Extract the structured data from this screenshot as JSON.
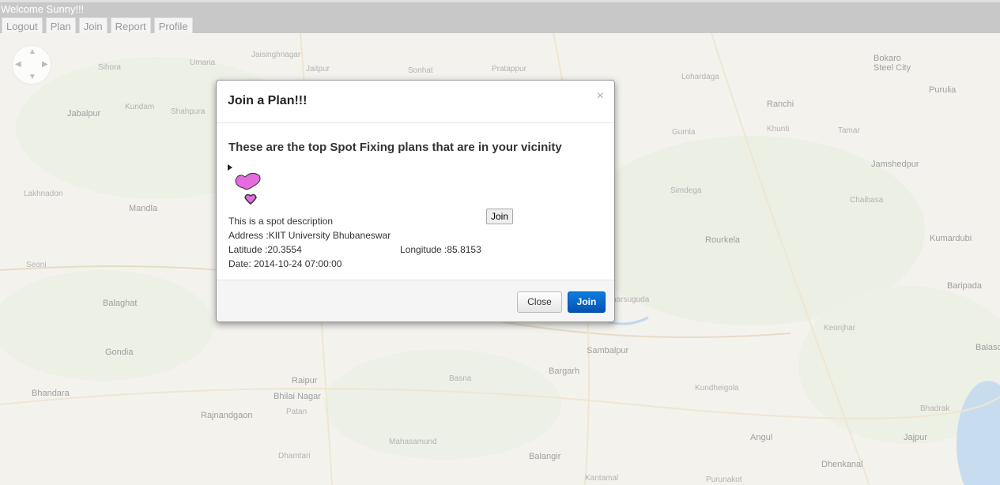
{
  "header": {
    "welcome": "Welcome Sunny!!!",
    "nav": [
      "Logout",
      "Plan",
      "Join",
      "Report",
      "Profile"
    ]
  },
  "map": {
    "labels": [
      {
        "t": "Sihora"
      },
      {
        "t": "Umaria"
      },
      {
        "t": "Jaisinghnagar"
      },
      {
        "t": "Jaitpur"
      },
      {
        "t": "Sonhat"
      },
      {
        "t": "Pratappur"
      },
      {
        "t": "Lohardaga"
      },
      {
        "t": "Ranchi"
      },
      {
        "t": "Bokaro Steel City"
      },
      {
        "t": "Purulia"
      },
      {
        "t": "Jabalpur"
      },
      {
        "t": "Kundam"
      },
      {
        "t": "Shahpura"
      },
      {
        "t": "Gumla"
      },
      {
        "t": "Khunti"
      },
      {
        "t": "Tamar"
      },
      {
        "t": "Jamshedpur"
      },
      {
        "t": "Lakhnadon"
      },
      {
        "t": "Mandla"
      },
      {
        "t": "Simdega"
      },
      {
        "t": "Chaibasa"
      },
      {
        "t": "Seoni"
      },
      {
        "t": "Balaghat"
      },
      {
        "t": "Rourkela"
      },
      {
        "t": "Kumardubi"
      },
      {
        "t": "Baripada"
      },
      {
        "t": "Gondia"
      },
      {
        "t": "Sambalpur"
      },
      {
        "t": "Keonjhar"
      },
      {
        "t": "Balasore"
      },
      {
        "t": "Bhandara"
      },
      {
        "t": "Raipur"
      },
      {
        "t": "Bhilai Nagar"
      },
      {
        "t": "Patan"
      },
      {
        "t": "Rajnandgaon"
      },
      {
        "t": "Mahasamund"
      },
      {
        "t": "Bargarh"
      },
      {
        "t": "Jharsuguda"
      },
      {
        "t": "Angul"
      },
      {
        "t": "Jajpur"
      },
      {
        "t": "Dhenkanal"
      },
      {
        "t": "Dhamtari"
      },
      {
        "t": "Balangir"
      },
      {
        "t": "Kantamal"
      },
      {
        "t": "Purunakot"
      },
      {
        "t": "Bhadrak"
      },
      {
        "t": "Kundheigola"
      },
      {
        "t": "Basna"
      }
    ]
  },
  "modal": {
    "title": "Join a Plan!!!",
    "close_symbol": "×",
    "heading": "These are the top Spot Fixing plans that are in your vicinity",
    "description": "This is a spot description",
    "address": "Address :KIIT University Bhubaneswar",
    "latitude": "Latitude :20.3554",
    "longitude": "Longitude :85.8153",
    "date": "Date: 2014-10-24 07:00:00",
    "inline_join": "Join",
    "close_button": "Close",
    "join_button": "Join"
  },
  "colors": {
    "primary": "#0a6bd0",
    "topbar": "#c8c8c8"
  }
}
